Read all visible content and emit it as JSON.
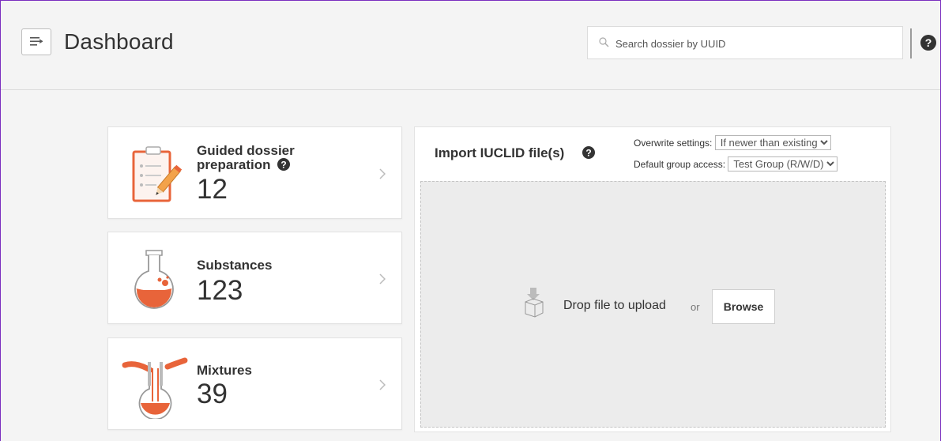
{
  "header": {
    "title": "Dashboard",
    "search_placeholder": "Search dossier by UUID"
  },
  "cards": [
    {
      "label_line1": "Guided dossier",
      "label_line2": "preparation",
      "count": "12",
      "icon": "clipboard-pencil-icon"
    },
    {
      "label": "Substances",
      "count": "123",
      "icon": "flask-icon"
    },
    {
      "label": "Mixtures",
      "count": "39",
      "icon": "pouring-flasks-icon"
    }
  ],
  "import": {
    "title": "Import IUCLID file(s)",
    "overwrite_label": "Overwrite settings:",
    "overwrite_value": "If newer than existing",
    "group_label": "Default group access:",
    "group_value": "Test Group (R/W/D)",
    "drop_text": "Drop file to upload",
    "or_text": "or",
    "browse_label": "Browse"
  },
  "colors": {
    "accent_orange": "#e8643a",
    "frame_purple": "#7b2fbf"
  }
}
